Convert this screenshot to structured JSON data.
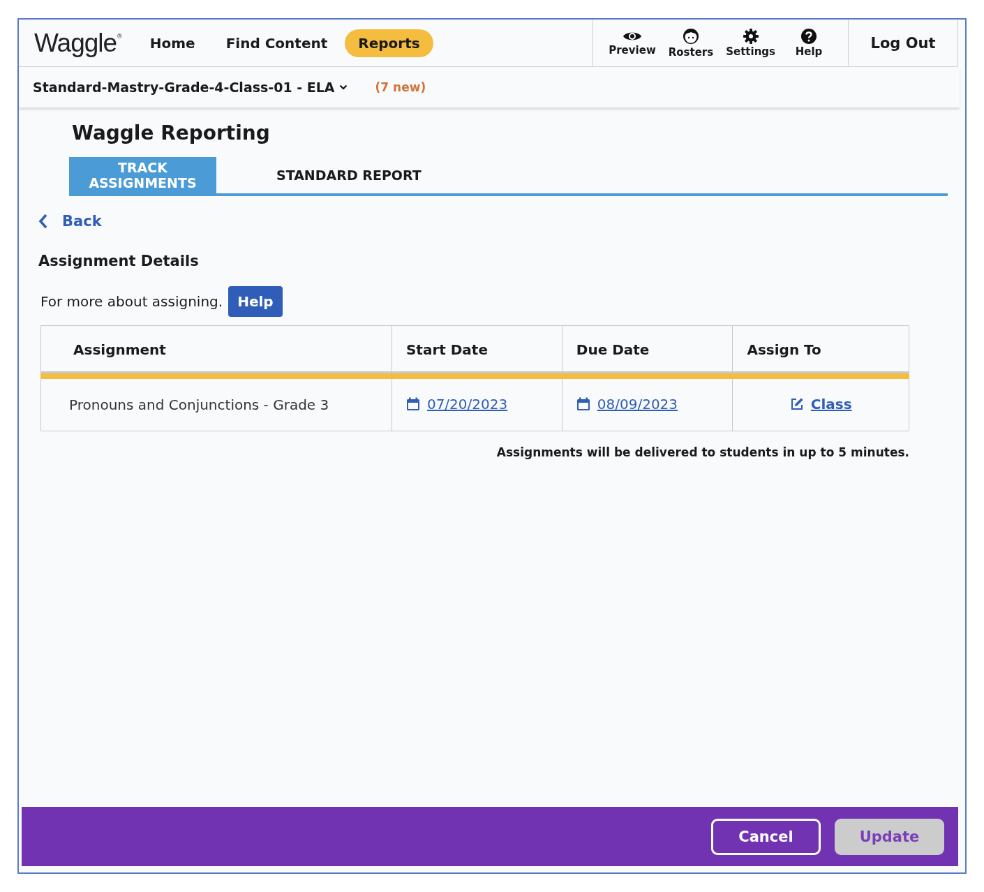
{
  "header": {
    "logo": "Waggle",
    "logo_mark": "®",
    "nav": [
      {
        "label": "Home",
        "selected": false
      },
      {
        "label": "Find Content",
        "selected": false
      },
      {
        "label": "Reports",
        "selected": true
      }
    ],
    "tools": [
      {
        "kind": "eye",
        "label": "Preview"
      },
      {
        "kind": "face",
        "label": "Rosters"
      },
      {
        "kind": "gear",
        "label": "Settings"
      },
      {
        "kind": "help",
        "label": "Help"
      }
    ],
    "logout": "Log Out"
  },
  "class_bar": {
    "class_name": "Standard-Mastry-Grade-4-Class-01 - ELA",
    "new_count": "(7 new)"
  },
  "page_title": "Waggle Reporting",
  "tabs": [
    {
      "label": "TRACK ASSIGNMENTS",
      "selected": true
    },
    {
      "label": "STANDARD REPORT",
      "selected": false
    }
  ],
  "back": "Back",
  "section_title": "Assignment Details",
  "help_text": "For more about assigning.",
  "help_button": "Help",
  "table": {
    "columns": [
      "Assignment",
      "Start Date",
      "Due Date",
      "Assign To"
    ],
    "rows": [
      {
        "assignment": "Pronouns and Conjunctions - Grade 3",
        "start_date": "07/20/2023",
        "due_date": "08/09/2023",
        "assign_to": "Class"
      }
    ]
  },
  "note": "Assignments will be delivered to students in up to 5 minutes.",
  "footer": {
    "buttons": [
      {
        "label": "Cancel",
        "kind": "outline",
        "disabled": false
      },
      {
        "label": "Update",
        "kind": "filled",
        "disabled": true
      }
    ]
  }
}
